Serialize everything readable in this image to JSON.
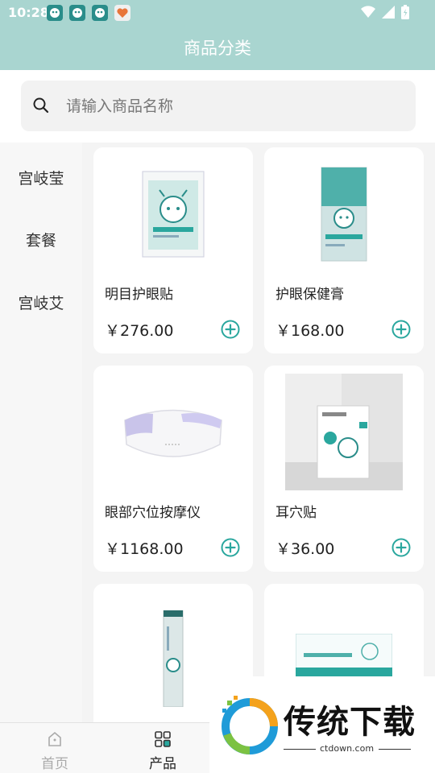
{
  "status_bar": {
    "time": "10:28"
  },
  "header": {
    "title": "商品分类"
  },
  "search": {
    "placeholder": "请输入商品名称",
    "value": ""
  },
  "sidebar": {
    "categories": [
      "宫岐莹",
      "套餐",
      "宫岐艾"
    ]
  },
  "products": [
    {
      "name": "明目护眼贴",
      "price": "￥276.00"
    },
    {
      "name": "护眼保健膏",
      "price": "￥168.00"
    },
    {
      "name": "眼部穴位按摩仪",
      "price": "￥1168.00"
    },
    {
      "name": "耳穴贴",
      "price": "￥36.00"
    },
    {
      "name": "",
      "price": ""
    },
    {
      "name": "",
      "price": ""
    }
  ],
  "tabbar": {
    "tabs": [
      "首页",
      "产品"
    ],
    "active": "产品"
  },
  "watermark": {
    "title": "传统下载",
    "url": "ctdown.com"
  },
  "colors": {
    "header_bg": "#a9d5d0",
    "accent": "#2aa79e",
    "tab_inactive": "#aaaaaa"
  },
  "icons": [
    "search-icon",
    "add-circle-icon",
    "home-icon",
    "products-icon"
  ]
}
